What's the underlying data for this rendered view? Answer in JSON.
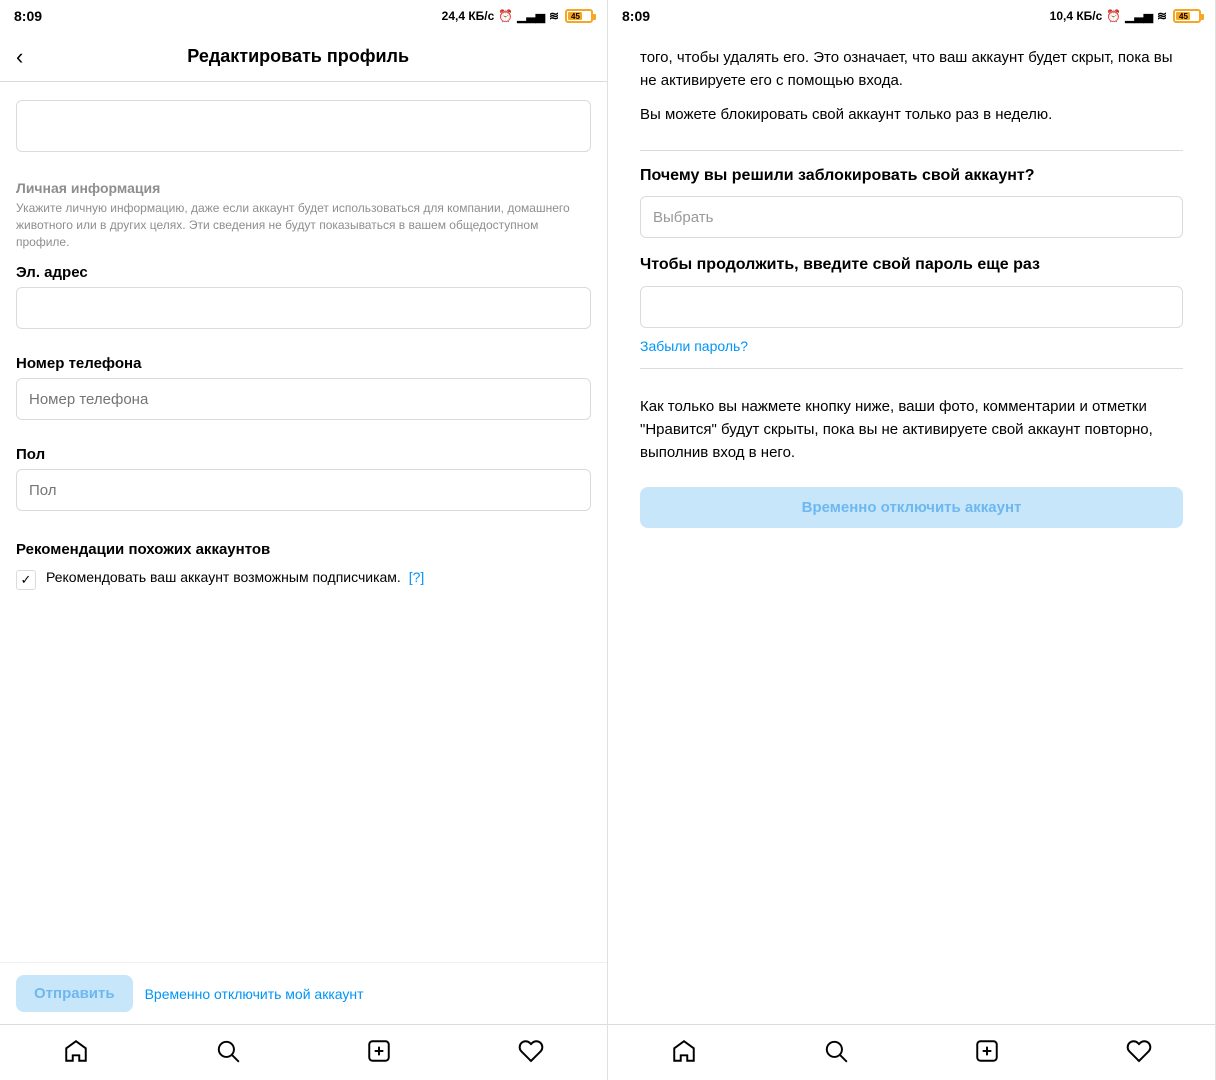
{
  "left_panel": {
    "status": {
      "time": "8:09",
      "network": "24,4 КБ/с",
      "battery": "45"
    },
    "header": {
      "back_label": "‹",
      "title": "Редактировать профиль"
    },
    "sections": {
      "personal_info_title": "Личная информация",
      "personal_info_desc": "Укажите личную информацию, даже если аккаунт будет использоваться для компании, домашнего животного или в других целях. Эти сведения не будут показываться в вашем общедоступном профиле.",
      "email_label": "Эл. адрес",
      "email_placeholder": "",
      "phone_label": "Номер телефона",
      "phone_placeholder": "Номер телефона",
      "gender_label": "Пол",
      "gender_placeholder": "Пол",
      "recommendations_title": "Рекомендации похожих аккаунтов",
      "checkbox_label": "Рекомендовать ваш аккаунт возможным подписчикам.",
      "help_link": "[?]",
      "submit_btn": "Отправить",
      "disable_link": "Временно отключить мой аккаунт"
    },
    "nav": {
      "home": "home",
      "search": "search",
      "add": "add",
      "heart": "heart"
    }
  },
  "right_panel": {
    "status": {
      "time": "8:09",
      "network": "10,4 КБ/с",
      "battery": "45"
    },
    "body_text_1": "того, чтобы удалять его. Это означает, что ваш аккаунт будет скрыт, пока вы не активируете его с помощью входа.",
    "body_text_2": "Вы можете блокировать свой аккаунт только раз в неделю.",
    "why_title": "Почему вы решили заблокировать свой аккаунт?",
    "select_placeholder": "Выбрать",
    "password_section_title": "Чтобы продолжить, введите свой пароль еще раз",
    "password_placeholder": "",
    "forgot_password": "Забыли пароль?",
    "bottom_info": "Как только вы нажмете кнопку ниже, ваши фото, комментарии и отметки \"Нравится\" будут скрыты, пока вы не активируете свой аккаунт повторно, выполнив вход в него.",
    "disable_btn": "Временно отключить аккаунт",
    "nav": {
      "home": "home",
      "search": "search",
      "add": "add",
      "heart": "heart"
    }
  }
}
